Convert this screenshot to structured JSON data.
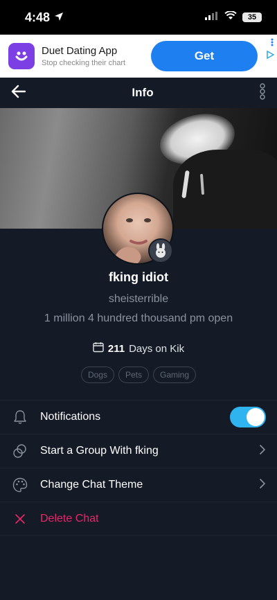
{
  "status_bar": {
    "time": "4:48",
    "battery": "35"
  },
  "ad": {
    "title": "Duet Dating App",
    "subtitle": "Stop checking their chart",
    "cta": "Get"
  },
  "nav": {
    "title": "Info"
  },
  "profile": {
    "display_name": "fking idiot",
    "username": "sheisterrible",
    "bio": "1 million 4 hundred thousand pm open",
    "days_count": "211",
    "days_label": "Days on Kik",
    "tags": [
      "Dogs",
      "Pets",
      "Gaming"
    ]
  },
  "menu": {
    "notifications": {
      "label": "Notifications",
      "enabled": true
    },
    "start_group": {
      "label": "Start a Group With fking"
    },
    "change_theme": {
      "label": "Change Chat Theme"
    },
    "delete_chat": {
      "label": "Delete Chat"
    }
  },
  "colors": {
    "background": "#141b26",
    "accent": "#2fb4f0",
    "danger": "#e8276b",
    "ad_button": "#1e80f0"
  },
  "icons": {
    "status": [
      "location-arrow-icon",
      "signal-icon",
      "wifi-icon",
      "battery-icon"
    ],
    "nav": [
      "back-arrow-icon",
      "more-vertical-icon"
    ],
    "menu": [
      "bell-icon",
      "group-circles-icon",
      "palette-icon",
      "close-x-icon",
      "chevron-right-icon"
    ]
  }
}
